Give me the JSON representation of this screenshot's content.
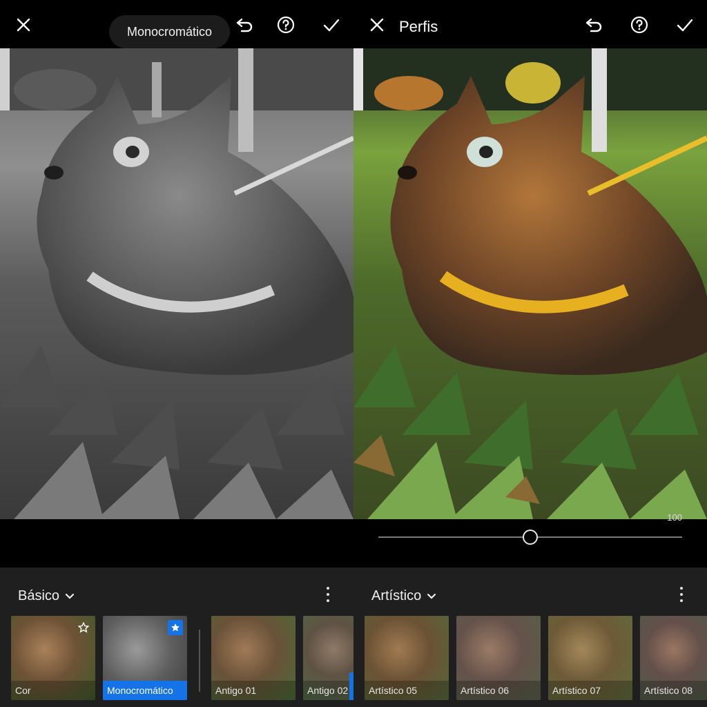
{
  "left_panel": {
    "tooltip": "Monocromático",
    "group": {
      "label": "Básico"
    },
    "profiles": [
      {
        "label": "Cor",
        "favorite": false,
        "selected": false
      },
      {
        "label": "Monocromático",
        "favorite": true,
        "selected": true
      },
      {
        "label": "Antigo 01",
        "favorite": false,
        "selected": false
      },
      {
        "label": "Antigo 02",
        "favorite": false,
        "selected": false
      }
    ]
  },
  "right_panel": {
    "title": "Perfis",
    "slider": {
      "value": "100",
      "level_percent": 50
    },
    "group": {
      "label": "Artístico"
    },
    "profiles": [
      {
        "label": "Artístico 05"
      },
      {
        "label": "Artístico 06"
      },
      {
        "label": "Artístico 07"
      },
      {
        "label": "Artístico 08"
      }
    ]
  },
  "colors": {
    "accent": "#1473e6",
    "background": "#000000",
    "profile_strip": "#1f1f1f"
  },
  "icons": {
    "close": "close-icon",
    "undo": "undo-icon",
    "help": "help-icon",
    "confirm": "checkmark-icon",
    "group_dropdown": "chevron-down-icon",
    "more": "more-vertical-icon",
    "favorite": "star-icon"
  }
}
